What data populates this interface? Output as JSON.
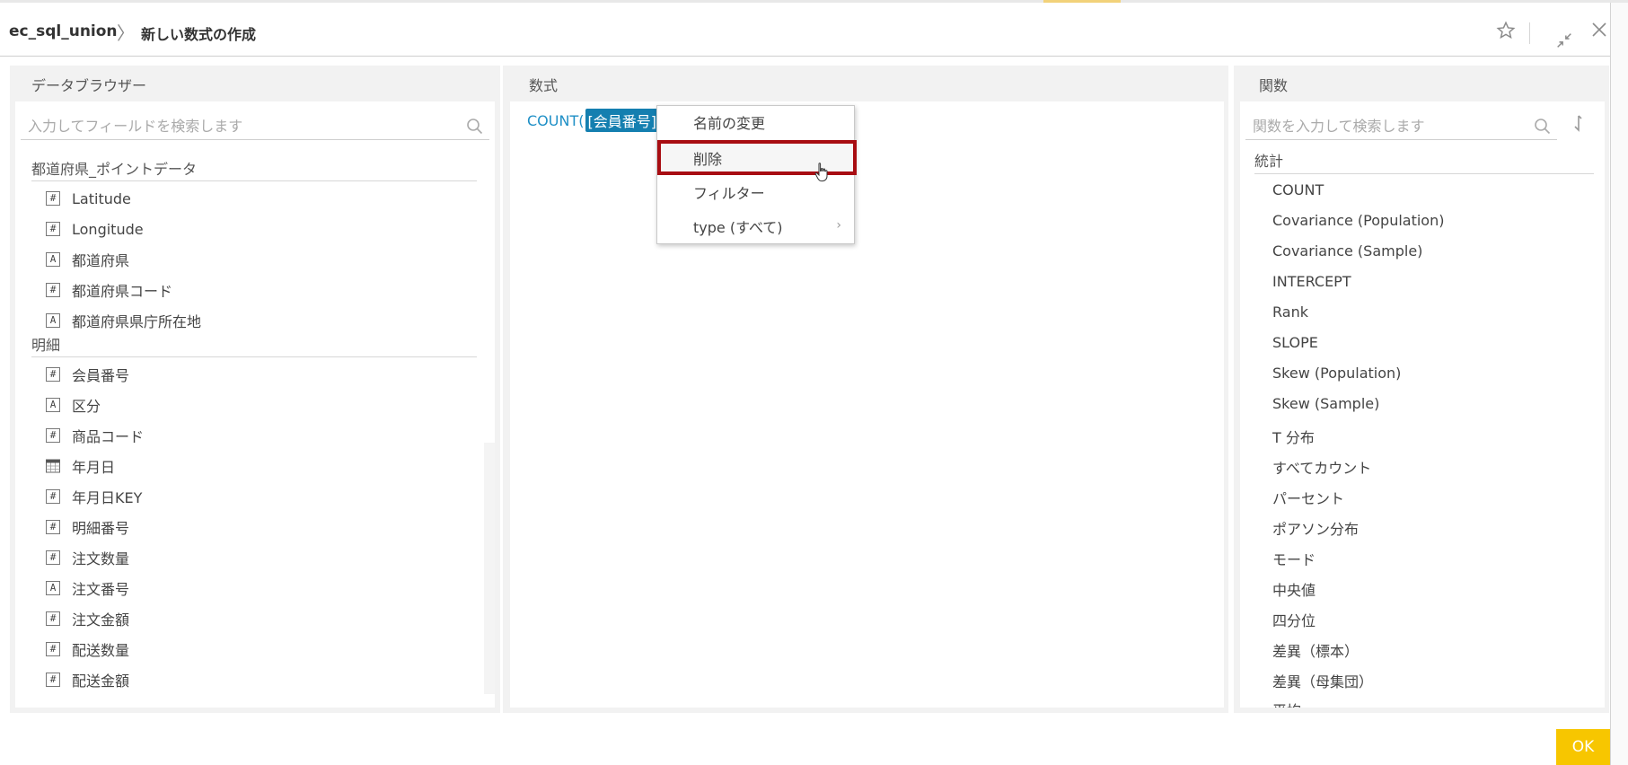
{
  "header": {
    "breadcrumb_root": "ec_sql_union",
    "breadcrumb_separator": "〉",
    "breadcrumb_current": "新しい数式の作成"
  },
  "left_panel": {
    "title": "データブラウザー",
    "search_placeholder": "入力してフィールドを検索します",
    "groups": [
      {
        "name": "都道府県_ポイントデータ",
        "fields": [
          {
            "type": "#",
            "label": "Latitude"
          },
          {
            "type": "#",
            "label": "Longitude"
          },
          {
            "type": "A",
            "label": "都道府県"
          },
          {
            "type": "#",
            "label": "都道府県コード"
          },
          {
            "type": "A",
            "label": "都道府県県庁所在地"
          }
        ]
      },
      {
        "name": "明細",
        "fields": [
          {
            "type": "#",
            "label": "会員番号"
          },
          {
            "type": "A",
            "label": "区分"
          },
          {
            "type": "#",
            "label": "商品コード"
          },
          {
            "type": "calendar",
            "label": "年月日"
          },
          {
            "type": "#",
            "label": "年月日KEY"
          },
          {
            "type": "#",
            "label": "明細番号"
          },
          {
            "type": "#",
            "label": "注文数量"
          },
          {
            "type": "A",
            "label": "注文番号"
          },
          {
            "type": "#",
            "label": "注文金額"
          },
          {
            "type": "#",
            "label": "配送数量"
          },
          {
            "type": "#",
            "label": "配送金額"
          }
        ]
      }
    ]
  },
  "middle_panel": {
    "title": "数式",
    "formula_prefix": "COUNT(",
    "formula_token": "[会員番号]"
  },
  "context_menu": {
    "items": [
      {
        "label": "名前の変更"
      },
      {
        "label": "削除"
      },
      {
        "label": "フィルター"
      },
      {
        "label": "type (すべて)"
      }
    ],
    "highlighted_item": "削除"
  },
  "right_panel": {
    "title": "関数",
    "search_placeholder": "関数を入力して検索します",
    "category": "統計",
    "functions": [
      "COUNT",
      "Covariance (Population)",
      "Covariance (Sample)",
      "INTERCEPT",
      "Rank",
      "SLOPE",
      "Skew (Population)",
      "Skew (Sample)",
      "T 分布",
      "すべてカウント",
      "パーセント",
      "ポアソン分布",
      "モード",
      "中央値",
      "四分位",
      "差異（標本）",
      "差異（母集団）",
      "平均"
    ]
  },
  "footer": {
    "ok_label": "OK"
  },
  "colors": {
    "accent_yellow": "#f7c600",
    "highlight_red": "#a80d12",
    "token_blue": "#147fb0",
    "formula_blue": "#1e8fc6"
  }
}
